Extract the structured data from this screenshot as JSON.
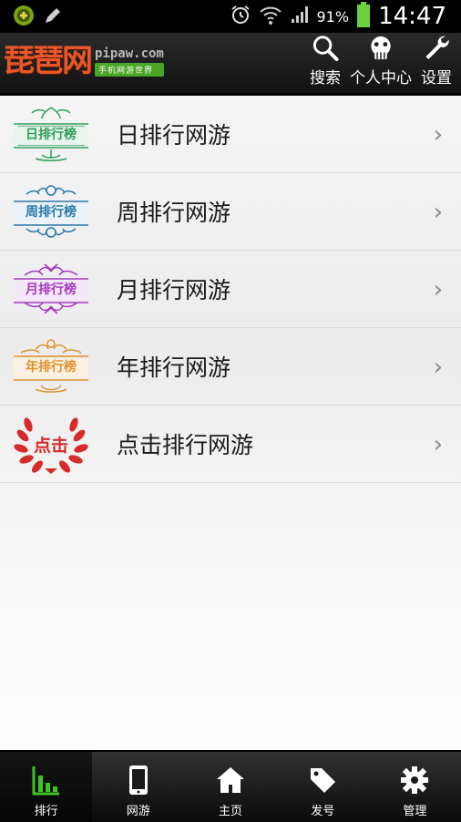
{
  "status_bar": {
    "battery_percent": "91%",
    "time": "14:47",
    "icons": [
      "app-notification-icon",
      "pencil-icon",
      "alarm-icon",
      "wifi-icon",
      "signal-icon",
      "battery-icon"
    ]
  },
  "header": {
    "logo_cn": "琵琶网",
    "logo_en": "pipaw.com",
    "logo_tagline": "手机网游世界",
    "actions": [
      {
        "label": "搜索",
        "icon": "search-icon"
      },
      {
        "label": "个人中心",
        "icon": "user-center-icon"
      },
      {
        "label": "设置",
        "icon": "wrench-icon"
      }
    ]
  },
  "ranking_list": [
    {
      "label": "日排行网游",
      "badge_text": "日排行榜",
      "badge_color": "#2e9e58"
    },
    {
      "label": "周排行网游",
      "badge_text": "周排行榜",
      "badge_color": "#2a79a8"
    },
    {
      "label": "月排行网游",
      "badge_text": "月排行榜",
      "badge_color": "#a43ac0"
    },
    {
      "label": "年排行网游",
      "badge_text": "年排行榜",
      "badge_color": "#e0922a"
    },
    {
      "label": "点击排行网游",
      "badge_text": "点击",
      "badge_color": "#d52b2b"
    }
  ],
  "bottom_nav": [
    {
      "label": "排行",
      "icon": "bar-chart-icon",
      "active": true
    },
    {
      "label": "网游",
      "icon": "phone-icon"
    },
    {
      "label": "主页",
      "icon": "home-icon"
    },
    {
      "label": "发号",
      "icon": "tag-icon"
    },
    {
      "label": "管理",
      "icon": "gear-icon"
    }
  ],
  "colors": {
    "accent_green": "#3ec41e",
    "header_bg": "#1e1e1e",
    "logo_orange": "#e8572a"
  }
}
